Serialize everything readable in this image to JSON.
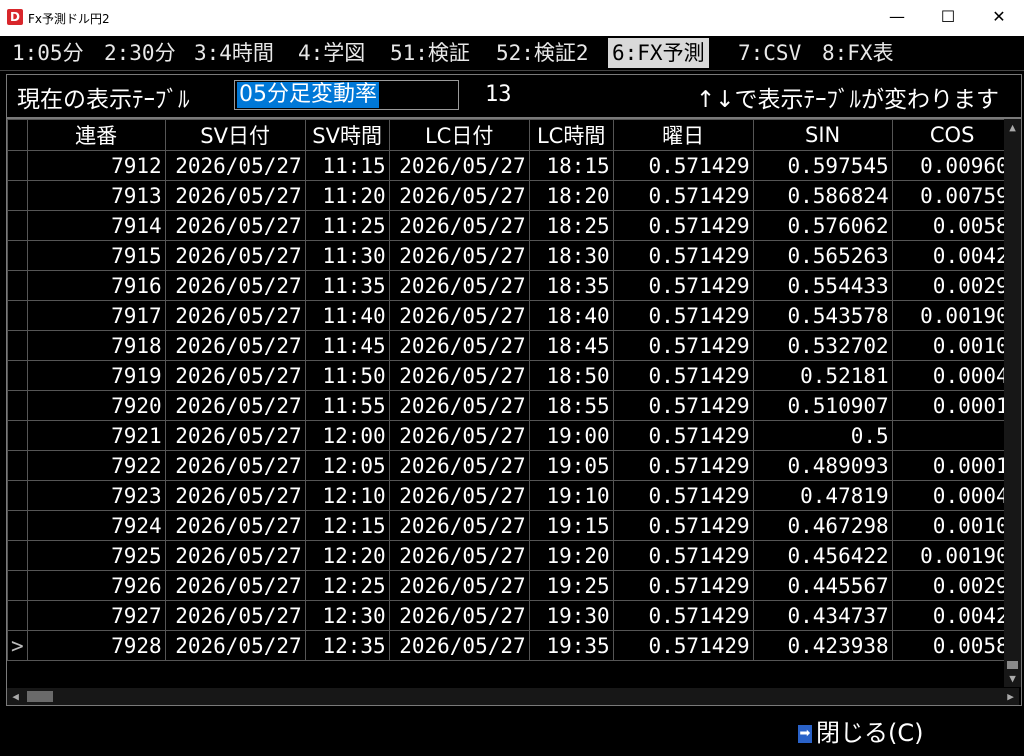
{
  "window": {
    "icon_letter": "D",
    "title": "Fx予測ドル円2",
    "minimize": "—",
    "maximize": "☐",
    "close": "✕"
  },
  "tabs": [
    {
      "label": "1:05分",
      "active": false
    },
    {
      "label": "2:30分",
      "active": false
    },
    {
      "label": "3:4時間",
      "active": false
    },
    {
      "label": "4:学図",
      "active": false
    },
    {
      "label": "51:検証",
      "active": false
    },
    {
      "label": "52:検証2",
      "active": false
    },
    {
      "label": "6:FX予測",
      "active": true
    },
    {
      "label": "7:CSV",
      "active": false
    },
    {
      "label": "8:FX表",
      "active": false
    }
  ],
  "info": {
    "current_label": "現在の表示ﾃｰﾌﾞﾙ",
    "table_name": "05分足変動率",
    "count": "13",
    "hint": "↑↓で表示ﾃｰﾌﾞﾙが変わります"
  },
  "grid": {
    "columns": [
      "連番",
      "SV日付",
      "SV時間",
      "LC日付",
      "LC時間",
      "曜日",
      "SIN",
      "COS"
    ],
    "current_row_marker": ">",
    "rows": [
      [
        "7912",
        "2026/05/27",
        "11:15",
        "2026/05/27",
        "18:15",
        "0.571429",
        "0.597545",
        "0.00960"
      ],
      [
        "7913",
        "2026/05/27",
        "11:20",
        "2026/05/27",
        "18:20",
        "0.571429",
        "0.586824",
        "0.00759"
      ],
      [
        "7914",
        "2026/05/27",
        "11:25",
        "2026/05/27",
        "18:25",
        "0.571429",
        "0.576062",
        "0.0058"
      ],
      [
        "7915",
        "2026/05/27",
        "11:30",
        "2026/05/27",
        "18:30",
        "0.571429",
        "0.565263",
        "0.0042"
      ],
      [
        "7916",
        "2026/05/27",
        "11:35",
        "2026/05/27",
        "18:35",
        "0.571429",
        "0.554433",
        "0.0029"
      ],
      [
        "7917",
        "2026/05/27",
        "11:40",
        "2026/05/27",
        "18:40",
        "0.571429",
        "0.543578",
        "0.00190"
      ],
      [
        "7918",
        "2026/05/27",
        "11:45",
        "2026/05/27",
        "18:45",
        "0.571429",
        "0.532702",
        "0.0010"
      ],
      [
        "7919",
        "2026/05/27",
        "11:50",
        "2026/05/27",
        "18:50",
        "0.571429",
        "0.52181",
        "0.0004"
      ],
      [
        "7920",
        "2026/05/27",
        "11:55",
        "2026/05/27",
        "18:55",
        "0.571429",
        "0.510907",
        "0.0001"
      ],
      [
        "7921",
        "2026/05/27",
        "12:00",
        "2026/05/27",
        "19:00",
        "0.571429",
        "0.5",
        ""
      ],
      [
        "7922",
        "2026/05/27",
        "12:05",
        "2026/05/27",
        "19:05",
        "0.571429",
        "0.489093",
        "0.0001"
      ],
      [
        "7923",
        "2026/05/27",
        "12:10",
        "2026/05/27",
        "19:10",
        "0.571429",
        "0.47819",
        "0.0004"
      ],
      [
        "7924",
        "2026/05/27",
        "12:15",
        "2026/05/27",
        "19:15",
        "0.571429",
        "0.467298",
        "0.0010"
      ],
      [
        "7925",
        "2026/05/27",
        "12:20",
        "2026/05/27",
        "19:20",
        "0.571429",
        "0.456422",
        "0.00190"
      ],
      [
        "7926",
        "2026/05/27",
        "12:25",
        "2026/05/27",
        "19:25",
        "0.571429",
        "0.445567",
        "0.0029"
      ],
      [
        "7927",
        "2026/05/27",
        "12:30",
        "2026/05/27",
        "19:30",
        "0.571429",
        "0.434737",
        "0.0042"
      ],
      [
        "7928",
        "2026/05/27",
        "12:35",
        "2026/05/27",
        "19:35",
        "0.571429",
        "0.423938",
        "0.0058"
      ]
    ]
  },
  "footer": {
    "close_label": "閉じる(C)"
  },
  "colors": {
    "background": "#000000",
    "selection": "#0078d7",
    "active_tab": "#d9d9d9"
  }
}
